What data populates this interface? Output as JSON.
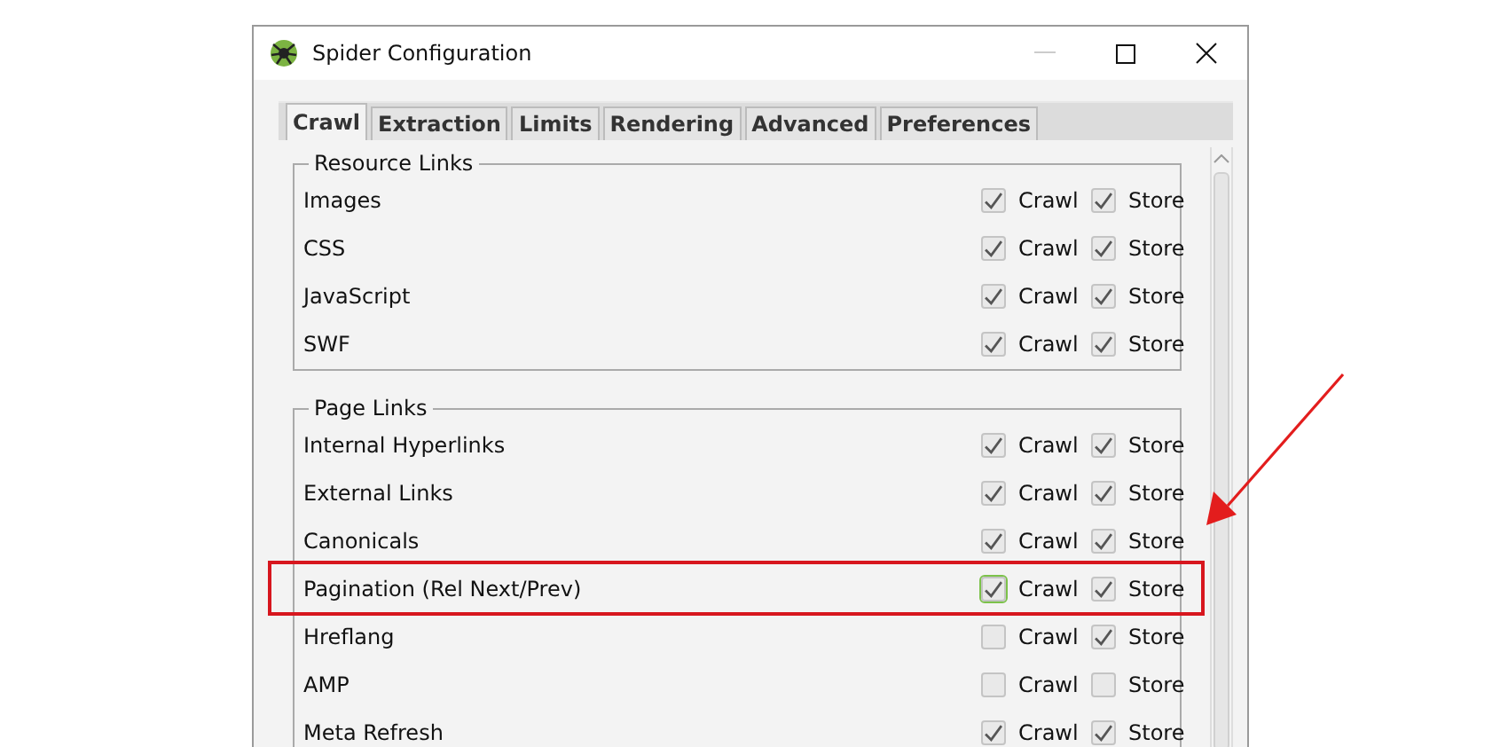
{
  "window": {
    "title": "Spider Configuration"
  },
  "tabs": [
    {
      "label": "Crawl",
      "selected": true
    },
    {
      "label": "Extraction",
      "selected": false
    },
    {
      "label": "Limits",
      "selected": false
    },
    {
      "label": "Rendering",
      "selected": false
    },
    {
      "label": "Advanced",
      "selected": false
    },
    {
      "label": "Preferences",
      "selected": false
    }
  ],
  "groups": [
    {
      "title": "Resource Links",
      "rows": [
        {
          "label": "Images",
          "highlighted": false,
          "options": [
            {
              "label": "Crawl",
              "checked": true,
              "focused": false
            },
            {
              "label": "Store",
              "checked": true,
              "focused": false
            }
          ]
        },
        {
          "label": "CSS",
          "highlighted": false,
          "options": [
            {
              "label": "Crawl",
              "checked": true,
              "focused": false
            },
            {
              "label": "Store",
              "checked": true,
              "focused": false
            }
          ]
        },
        {
          "label": "JavaScript",
          "highlighted": false,
          "options": [
            {
              "label": "Crawl",
              "checked": true,
              "focused": false
            },
            {
              "label": "Store",
              "checked": true,
              "focused": false
            }
          ]
        },
        {
          "label": "SWF",
          "highlighted": false,
          "options": [
            {
              "label": "Crawl",
              "checked": true,
              "focused": false
            },
            {
              "label": "Store",
              "checked": true,
              "focused": false
            }
          ]
        }
      ]
    },
    {
      "title": "Page Links",
      "rows": [
        {
          "label": "Internal Hyperlinks",
          "highlighted": false,
          "options": [
            {
              "label": "Crawl",
              "checked": true,
              "focused": false
            },
            {
              "label": "Store",
              "checked": true,
              "focused": false
            }
          ]
        },
        {
          "label": "External Links",
          "highlighted": false,
          "options": [
            {
              "label": "Crawl",
              "checked": true,
              "focused": false
            },
            {
              "label": "Store",
              "checked": true,
              "focused": false
            }
          ]
        },
        {
          "label": "Canonicals",
          "highlighted": false,
          "options": [
            {
              "label": "Crawl",
              "checked": true,
              "focused": false
            },
            {
              "label": "Store",
              "checked": true,
              "focused": false
            }
          ]
        },
        {
          "label": "Pagination (Rel Next/Prev)",
          "highlighted": true,
          "options": [
            {
              "label": "Crawl",
              "checked": true,
              "focused": true
            },
            {
              "label": "Store",
              "checked": true,
              "focused": false
            }
          ]
        },
        {
          "label": "Hreflang",
          "highlighted": false,
          "options": [
            {
              "label": "Crawl",
              "checked": false,
              "focused": false
            },
            {
              "label": "Store",
              "checked": true,
              "focused": false
            }
          ]
        },
        {
          "label": "AMP",
          "highlighted": false,
          "options": [
            {
              "label": "Crawl",
              "checked": false,
              "focused": false
            },
            {
              "label": "Store",
              "checked": false,
              "focused": false
            }
          ]
        },
        {
          "label": "Meta Refresh",
          "highlighted": false,
          "options": [
            {
              "label": "Crawl",
              "checked": true,
              "focused": false
            },
            {
              "label": "Store",
              "checked": true,
              "focused": false
            }
          ]
        }
      ]
    }
  ]
}
